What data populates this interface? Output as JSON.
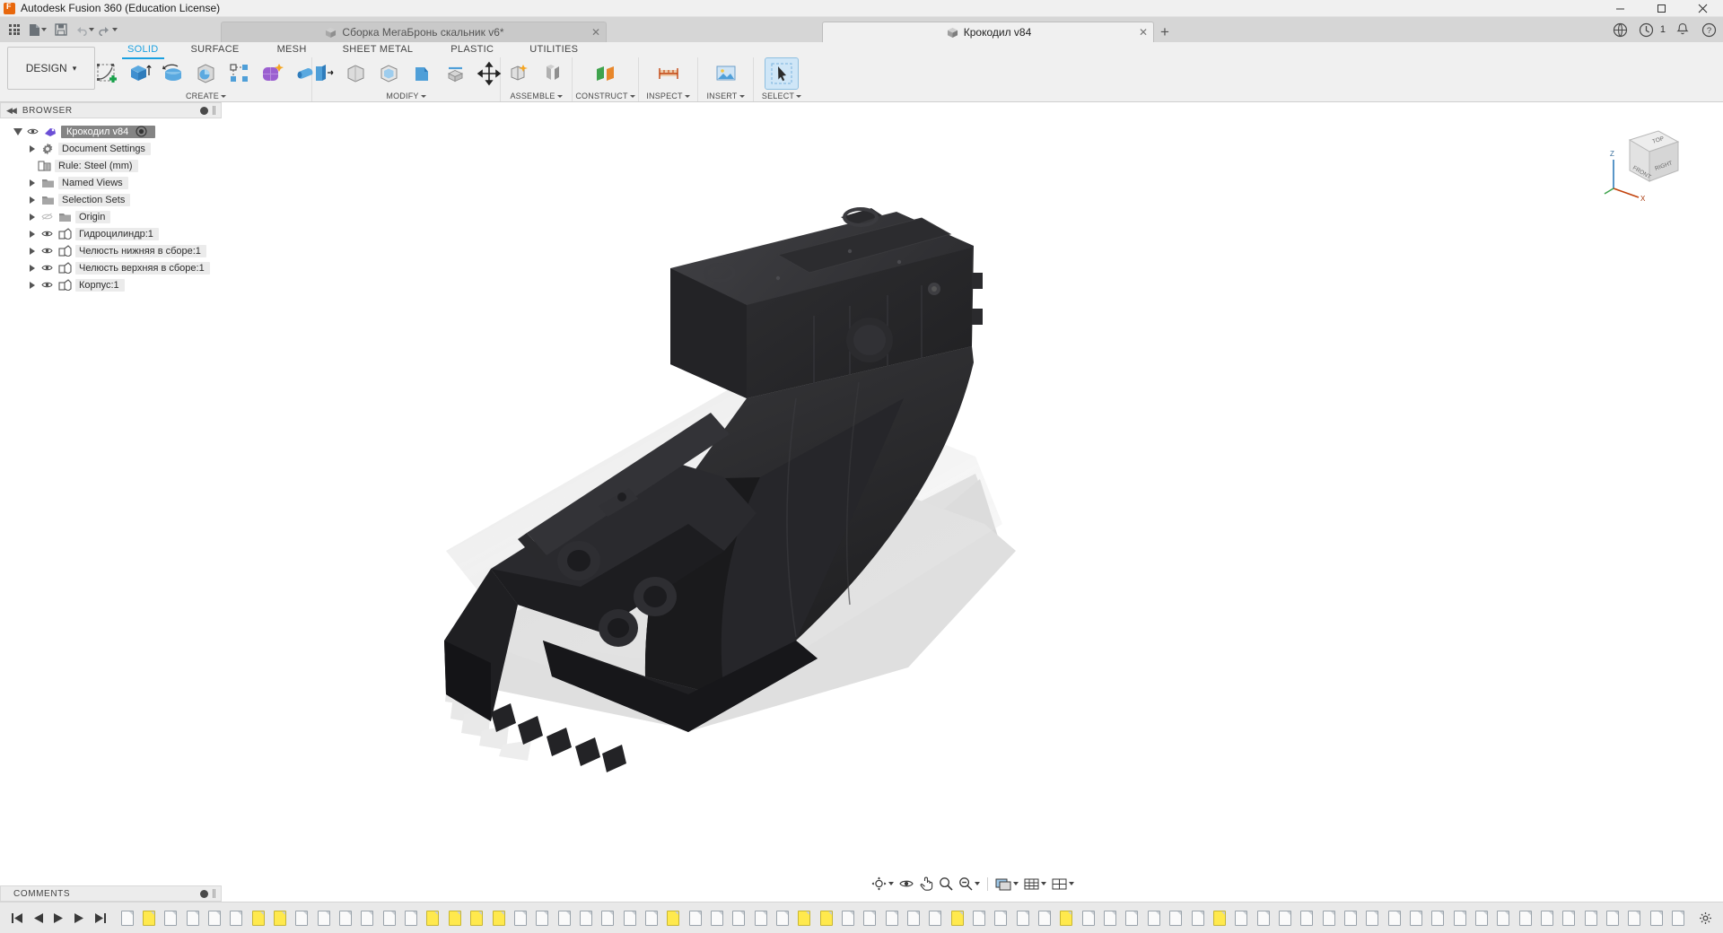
{
  "window": {
    "title": "Autodesk Fusion 360 (Education License)",
    "app_icon": "fusion-logo-icon",
    "minimize": "–",
    "maximize": "☐",
    "close": "✕"
  },
  "quick_access": {
    "app_grid": "app-grid-icon",
    "new_file": "new-file-icon",
    "save": "save-icon",
    "undo": "undo-icon",
    "redo": "redo-icon"
  },
  "document_tabs": [
    {
      "label": "Сборка МегаБронь скальник v6*",
      "active": false,
      "close": "✕"
    },
    {
      "label": "Крокодил v84",
      "active": true,
      "close": "✕"
    }
  ],
  "tab_add": "+",
  "header_tools": {
    "share_icon": "share-icon",
    "jobs_icon": "jobs-status-icon",
    "jobs_count": "1",
    "notifications_icon": "bell-icon",
    "help_icon": "help-icon"
  },
  "workspace": {
    "selector_label": "DESIGN",
    "selector_caret": "▾"
  },
  "ribbon_tabs": [
    {
      "label": "SOLID",
      "active": true
    },
    {
      "label": "SURFACE",
      "active": false
    },
    {
      "label": "MESH",
      "active": false
    },
    {
      "label": "SHEET METAL",
      "active": false
    },
    {
      "label": "PLASTIC",
      "active": false
    },
    {
      "label": "UTILITIES",
      "active": false
    }
  ],
  "ribbon_panels": [
    {
      "label": "CREATE",
      "caret": "▾",
      "tools": [
        {
          "name": "create-sketch-icon"
        },
        {
          "name": "extrude-icon"
        },
        {
          "name": "revolve-icon"
        },
        {
          "name": "sweep-icon"
        },
        {
          "name": "rectangular-pattern-icon"
        },
        {
          "name": "create-form-icon"
        },
        {
          "name": "pipe-icon"
        }
      ]
    },
    {
      "label": "MODIFY",
      "caret": "▾",
      "tools": [
        {
          "name": "press-pull-icon"
        },
        {
          "name": "fillet-icon"
        },
        {
          "name": "shell-icon"
        },
        {
          "name": "draft-icon"
        },
        {
          "name": "combine-icon"
        },
        {
          "name": "move-copy-icon"
        }
      ]
    },
    {
      "label": "ASSEMBLE",
      "caret": "▾",
      "tools": [
        {
          "name": "new-component-icon"
        },
        {
          "name": "joint-icon"
        }
      ]
    },
    {
      "label": "CONSTRUCT",
      "caret": "▾",
      "tools": [
        {
          "name": "offset-plane-icon"
        }
      ]
    },
    {
      "label": "INSPECT",
      "caret": "▾",
      "tools": [
        {
          "name": "measure-icon"
        }
      ]
    },
    {
      "label": "INSERT",
      "caret": "▾",
      "tools": [
        {
          "name": "insert-canvas-icon"
        }
      ]
    },
    {
      "label": "SELECT",
      "caret": "▾",
      "tools": [
        {
          "name": "select-arrow-icon",
          "selected": true
        }
      ]
    }
  ],
  "browser": {
    "title": "BROWSER",
    "collapse_icon": "collapse-left-icon",
    "settings_icon": "panel-dot-icon",
    "items": [
      {
        "label": "Крокодил v84",
        "indent": 0,
        "arrow": "open",
        "eye": true,
        "icon": "document-icon",
        "selected": true,
        "radio": true
      },
      {
        "label": "Document Settings",
        "indent": 1,
        "arrow": "closed",
        "eye": false,
        "icon": "gear-icon"
      },
      {
        "label": "Rule: Steel (mm)",
        "indent": 2,
        "arrow": "none",
        "eye": false,
        "icon": "rule-icon"
      },
      {
        "label": "Named Views",
        "indent": 1,
        "arrow": "closed",
        "eye": false,
        "icon": "folder-icon"
      },
      {
        "label": "Selection Sets",
        "indent": 1,
        "arrow": "closed",
        "eye": false,
        "icon": "folder-icon"
      },
      {
        "label": "Origin",
        "indent": 1,
        "arrow": "closed",
        "eye": true,
        "eye_off": true,
        "icon": "folder-icon"
      },
      {
        "label": "Гидроцилиндр:1",
        "indent": 1,
        "arrow": "closed",
        "eye": true,
        "icon": "component-icon"
      },
      {
        "label": "Челюсть нижняя в сборе:1",
        "indent": 1,
        "arrow": "closed",
        "eye": true,
        "icon": "component-icon"
      },
      {
        "label": "Челюсть верхняя в сборе:1",
        "indent": 1,
        "arrow": "closed",
        "eye": true,
        "icon": "component-icon"
      },
      {
        "label": "Корпус:1",
        "indent": 1,
        "arrow": "closed",
        "eye": true,
        "icon": "component-icon"
      }
    ]
  },
  "comments": {
    "title": "COMMENTS",
    "collapse_icon": "panel-dot-icon"
  },
  "viewcube": {
    "faces": {
      "top": "TOP",
      "front": "FRONT",
      "right": "RIGHT"
    },
    "axes": {
      "z": "Z",
      "x": "X"
    }
  },
  "nav_toolbar": [
    {
      "name": "orbit-icon",
      "caret": true
    },
    {
      "name": "look-at-icon",
      "caret": false
    },
    {
      "name": "pan-icon",
      "caret": false
    },
    {
      "name": "zoom-icon",
      "caret": false
    },
    {
      "name": "fit-icon",
      "caret": true
    },
    {
      "name": "display-settings-icon",
      "caret": true
    },
    {
      "name": "grid-snap-icon",
      "caret": true
    },
    {
      "name": "viewports-icon",
      "caret": true
    }
  ],
  "timeline": {
    "first_icon": "go-to-start-icon",
    "prev_icon": "step-back-icon",
    "play_icon": "play-icon",
    "next_icon": "step-forward-icon",
    "last_icon": "go-to-end-icon"
  },
  "taskbar": {
    "settings_icon": "gear-icon",
    "feature_count": 72,
    "highlighted_features": [
      1,
      6,
      7,
      14,
      15,
      16,
      17,
      25,
      31,
      32,
      38,
      43,
      50
    ],
    "group_icons": [
      "sketch-icon",
      "extrude-icon",
      "revolve-icon",
      "fillet-icon",
      "pattern-icon"
    ]
  },
  "colors": {
    "accent": "#1aa0e0",
    "titlebar_bg": "#f0f0f0",
    "tabstrip_bg": "#d6d6d6",
    "ribbon_bg": "#f0f0f0",
    "selection_bg": "#848484",
    "timeline_highlight": "#ffe94d",
    "model_color": "#262628",
    "viewport_bg": "#ffffff"
  }
}
